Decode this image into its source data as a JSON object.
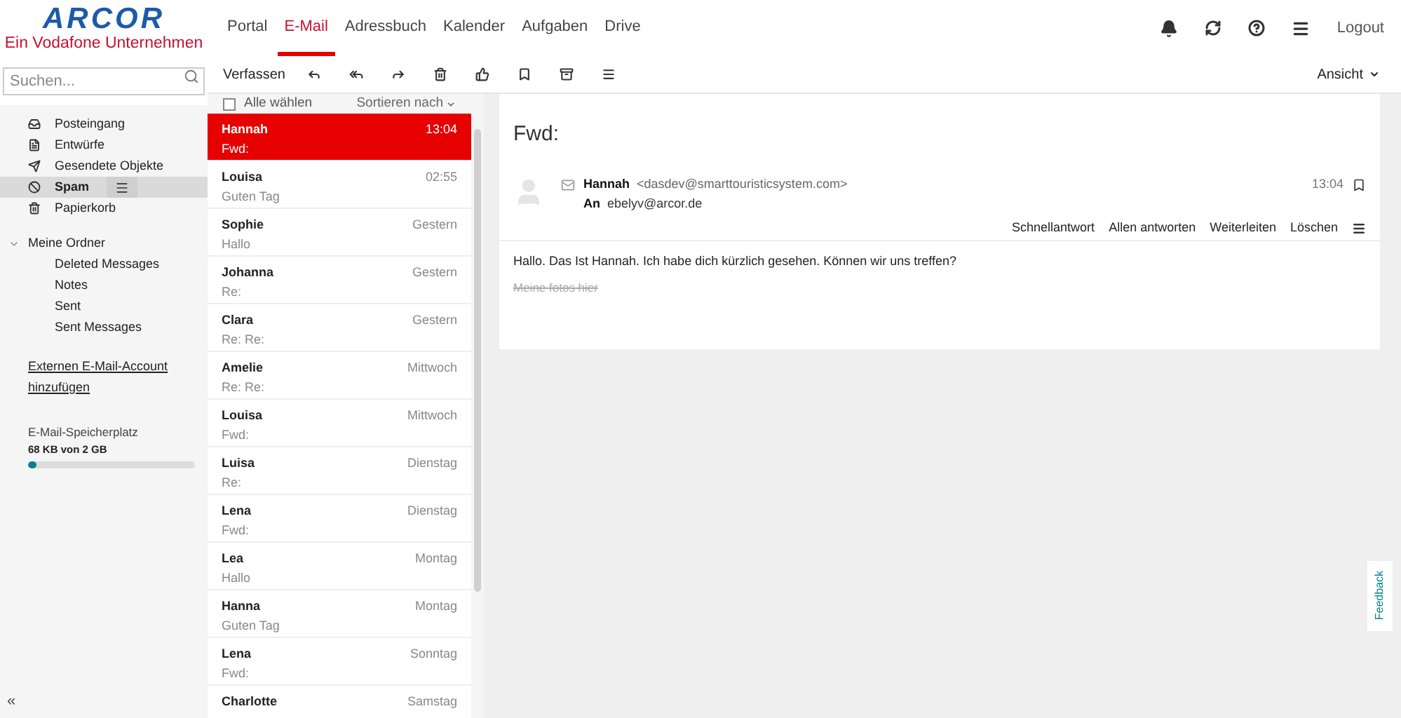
{
  "logo": {
    "brand": "ARCOR",
    "tagline": "Ein Vodafone Unternehmen"
  },
  "nav": [
    {
      "label": "Portal",
      "selected": false
    },
    {
      "label": "E-Mail",
      "selected": true
    },
    {
      "label": "Adressbuch",
      "selected": false
    },
    {
      "label": "Kalender",
      "selected": false
    },
    {
      "label": "Aufgaben",
      "selected": false
    },
    {
      "label": "Drive",
      "selected": false
    }
  ],
  "logout": "Logout",
  "search": {
    "placeholder": "Suchen..."
  },
  "toolbar": {
    "compose": "Verfassen",
    "view": "Ansicht"
  },
  "folders": [
    {
      "label": "Posteingang",
      "selected": false
    },
    {
      "label": "Entwürfe",
      "selected": false
    },
    {
      "label": "Gesendete Objekte",
      "selected": false
    },
    {
      "label": "Spam",
      "selected": true
    },
    {
      "label": "Papierkorb",
      "selected": false
    }
  ],
  "my_folders": {
    "label": "Meine Ordner",
    "expanded": true,
    "children": [
      {
        "label": "Deleted Messages"
      },
      {
        "label": "Notes"
      },
      {
        "label": "Sent"
      },
      {
        "label": "Sent Messages"
      }
    ]
  },
  "external_account_link": "Externen E-Mail-Account hinzufügen",
  "storage": {
    "label": "E-Mail-Speicherplatz",
    "usage": "68 KB von 2 GB",
    "level": 0.05
  },
  "collapse": "«",
  "list": {
    "select_all": {
      "label": "Alle wählen",
      "checked": false
    },
    "sort": "Sortieren nach",
    "messages": [
      {
        "sender": "Hannah",
        "subject": "Fwd:",
        "time": "13:04",
        "selected": true
      },
      {
        "sender": "Louisa",
        "subject": "Guten Tag",
        "time": "02:55",
        "selected": false
      },
      {
        "sender": "Sophie",
        "subject": "Hallo",
        "time": "Gestern",
        "selected": false
      },
      {
        "sender": "Johanna",
        "subject": "Re:",
        "time": "Gestern",
        "selected": false
      },
      {
        "sender": "Clara",
        "subject": "Re: Re:",
        "time": "Gestern",
        "selected": false
      },
      {
        "sender": "Amelie",
        "subject": "Re: Re:",
        "time": "Mittwoch",
        "selected": false
      },
      {
        "sender": "Louisa",
        "subject": "Fwd:",
        "time": "Mittwoch",
        "selected": false
      },
      {
        "sender": "Luisa",
        "subject": "Re:",
        "time": "Dienstag",
        "selected": false
      },
      {
        "sender": "Lena",
        "subject": "Fwd:",
        "time": "Dienstag",
        "selected": false
      },
      {
        "sender": "Lea",
        "subject": "Hallo",
        "time": "Montag",
        "selected": false
      },
      {
        "sender": "Hanna",
        "subject": "Guten Tag",
        "time": "Montag",
        "selected": false
      },
      {
        "sender": "Lena",
        "subject": "Fwd:",
        "time": "Sonntag",
        "selected": false
      },
      {
        "sender": "Charlotte",
        "time": "Samstag",
        "selected": false
      }
    ]
  },
  "message": {
    "subject": "Fwd:",
    "from_name": "Hannah",
    "from_email": "<dasdev@smarttouristicsystem.com>",
    "to_label": "An",
    "to": "ebelyv@arcor.de",
    "time": "13:04",
    "actions": [
      "Schnellantwort",
      "Allen antworten",
      "Weiterleiten",
      "Löschen"
    ],
    "body": "Hallo. Das Ist Hannah. Ich habe dich kürzlich gesehen. Können wir uns treffen?",
    "link": "Meine fotos hier"
  },
  "feedback": "Feedback"
}
